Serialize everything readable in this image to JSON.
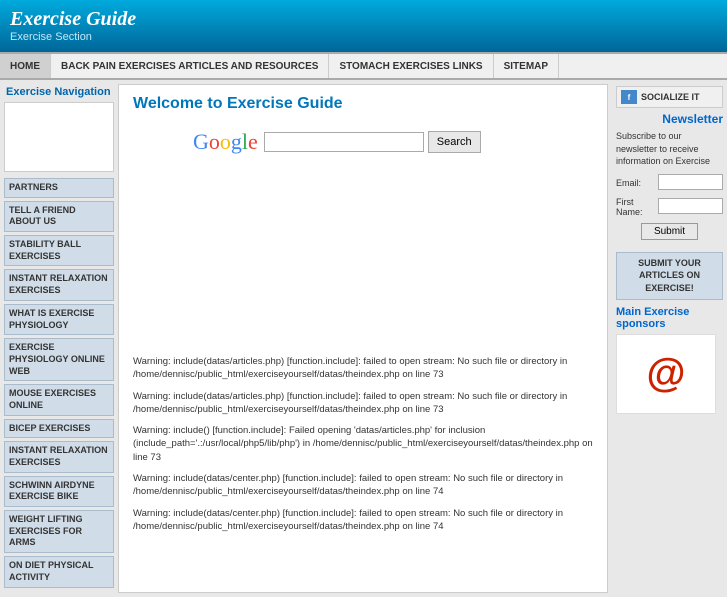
{
  "header": {
    "title": "Exercise Guide",
    "subtitle": "Exercise Section"
  },
  "navbar": {
    "items": [
      {
        "label": "HOME"
      },
      {
        "label": "BACK PAIN EXERCISES ARTICLES AND RESOURCES"
      },
      {
        "label": "STOMACH EXERCISES LINKS"
      },
      {
        "label": "SITEMAP"
      }
    ]
  },
  "sidebar": {
    "title": "Exercise Navigation",
    "buttons": [
      {
        "label": "PARTNERS"
      },
      {
        "label": "TELL A FRIEND ABOUT US"
      },
      {
        "label": "STABILITY BALL EXERCISES"
      },
      {
        "label": "INSTANT RELAXATION EXERCISES"
      },
      {
        "label": "WHAT IS EXERCISE PHYSIOLOGY"
      },
      {
        "label": "EXERCISE PHYSIOLOGY ONLINE WEB"
      },
      {
        "label": "MOUSE EXERCISES ONLINE"
      },
      {
        "label": "BICEP EXERCISES"
      },
      {
        "label": "INSTANT RELAXATION EXERCISES"
      },
      {
        "label": "SCHWINN AIRDYNE EXERCISE BIKE"
      },
      {
        "label": "WEIGHT LIFTING EXERCISES FOR ARMS"
      },
      {
        "label": "ON DIET PHYSICAL ACTIVITY"
      }
    ]
  },
  "content": {
    "title": "Welcome to Exercise Guide",
    "google": {
      "logo": "Google",
      "search_placeholder": "",
      "search_btn": "Search"
    },
    "warnings": [
      "Warning: include(datas/articles.php) [function.include]: failed to open stream: No such file or directory in /home/dennisc/public_html/exerciseyourself/datas/theindex.php on line 73",
      "Warning: include(datas/articles.php) [function.include]: failed to open stream: No such file or directory in /home/dennisc/public_html/exerciseyourself/datas/theindex.php on line 73",
      "Warning: include() [function.include]: Failed opening 'datas/articles.php' for inclusion (include_path='.:/usr/local/php5/lib/php') in /home/dennisc/public_html/exerciseyourself/datas/theindex.php on line 73",
      "Warning: include(datas/center.php) [function.include]: failed to open stream: No such file or directory in /home/dennisc/public_html/exerciseyourself/datas/theindex.php on line 74",
      "Warning: include(datas/center.php) [function.include]: failed to open stream: No such file or directory in /home/dennisc/public_html/exerciseyourself/datas/theindex.php on line 74"
    ]
  },
  "right_sidebar": {
    "socialize_label": "SOCIALIZE IT",
    "newsletter_title": "Newsletter",
    "newsletter_desc": "Subscribe to our newsletter to receive information on Exercise",
    "email_label": "Email:",
    "firstname_label": "First Name:",
    "submit_btn": "Submit",
    "submit_articles_btn": "SUBMIT YOUR ARTICLES ON EXERCISE!",
    "sponsors_title": "Main Exercise sponsors",
    "sponsor_icon": "@"
  }
}
